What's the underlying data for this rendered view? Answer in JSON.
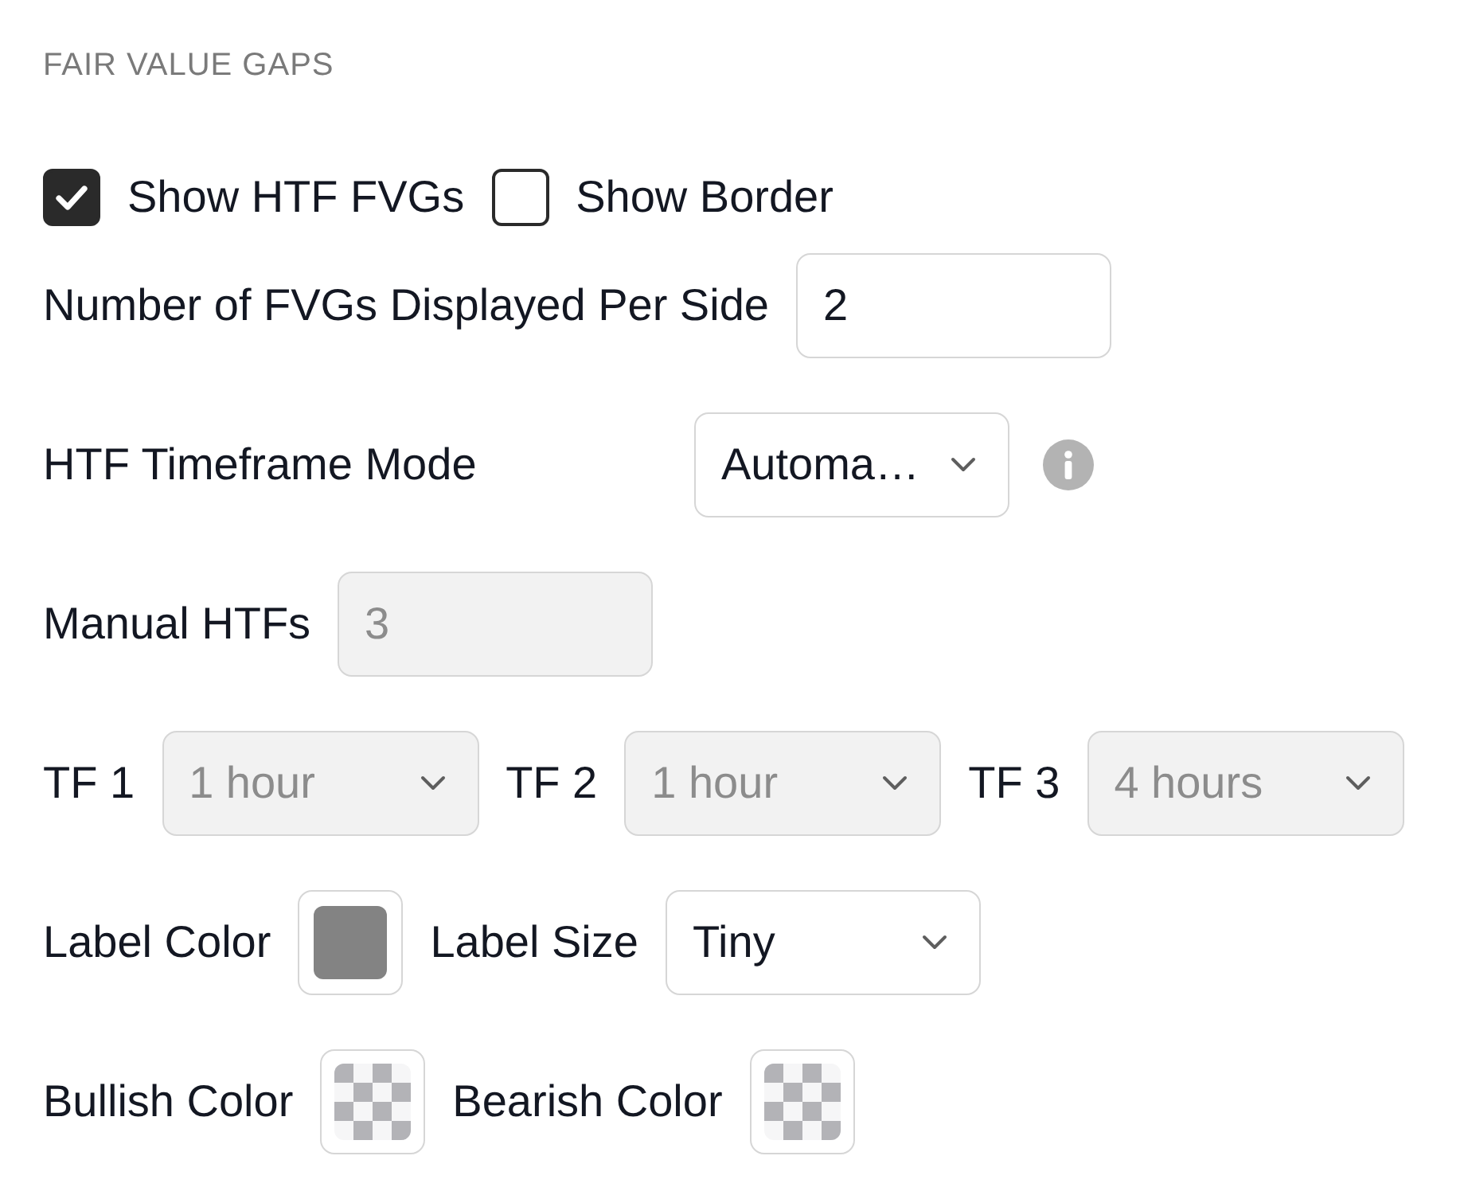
{
  "section_title": "FAIR VALUE GAPS",
  "rows": [
    {
      "kind": "checkboxes",
      "items": [
        {
          "label": "Show HTF FVGs",
          "checked": true
        },
        {
          "label": "Show Border",
          "checked": false
        }
      ]
    },
    {
      "kind": "inline",
      "items": [
        {
          "kind": "number",
          "label": "Number of FVGs Displayed Per Side",
          "value": "2",
          "disabled": false
        }
      ]
    },
    {
      "kind": "column",
      "items": [
        {
          "kind": "select",
          "label": "HTF Timeframe Mode",
          "value": "Automa…",
          "disabled": false,
          "info": true
        }
      ]
    },
    {
      "kind": "inline",
      "items": [
        {
          "kind": "number",
          "label": "Manual HTFs",
          "value": "3",
          "disabled": true
        }
      ]
    },
    {
      "kind": "inline",
      "items": [
        {
          "kind": "select",
          "label": "TF 1",
          "value": "1 hour",
          "disabled": true
        },
        {
          "kind": "select",
          "label": "TF 2",
          "value": "1 hour",
          "disabled": true
        },
        {
          "kind": "select",
          "label": "TF 3",
          "value": "4 hours",
          "disabled": true
        }
      ]
    },
    {
      "kind": "inline",
      "items": [
        {
          "kind": "color",
          "label": "Label Color",
          "color": "#838383",
          "transparent": false
        },
        {
          "kind": "select",
          "label": "Label Size",
          "value": "Tiny",
          "disabled": false
        }
      ]
    },
    {
      "kind": "inline",
      "items": [
        {
          "kind": "color",
          "label": "Bullish Color",
          "transparent": true
        },
        {
          "kind": "color",
          "label": "Bearish Color",
          "transparent": true
        }
      ]
    }
  ]
}
